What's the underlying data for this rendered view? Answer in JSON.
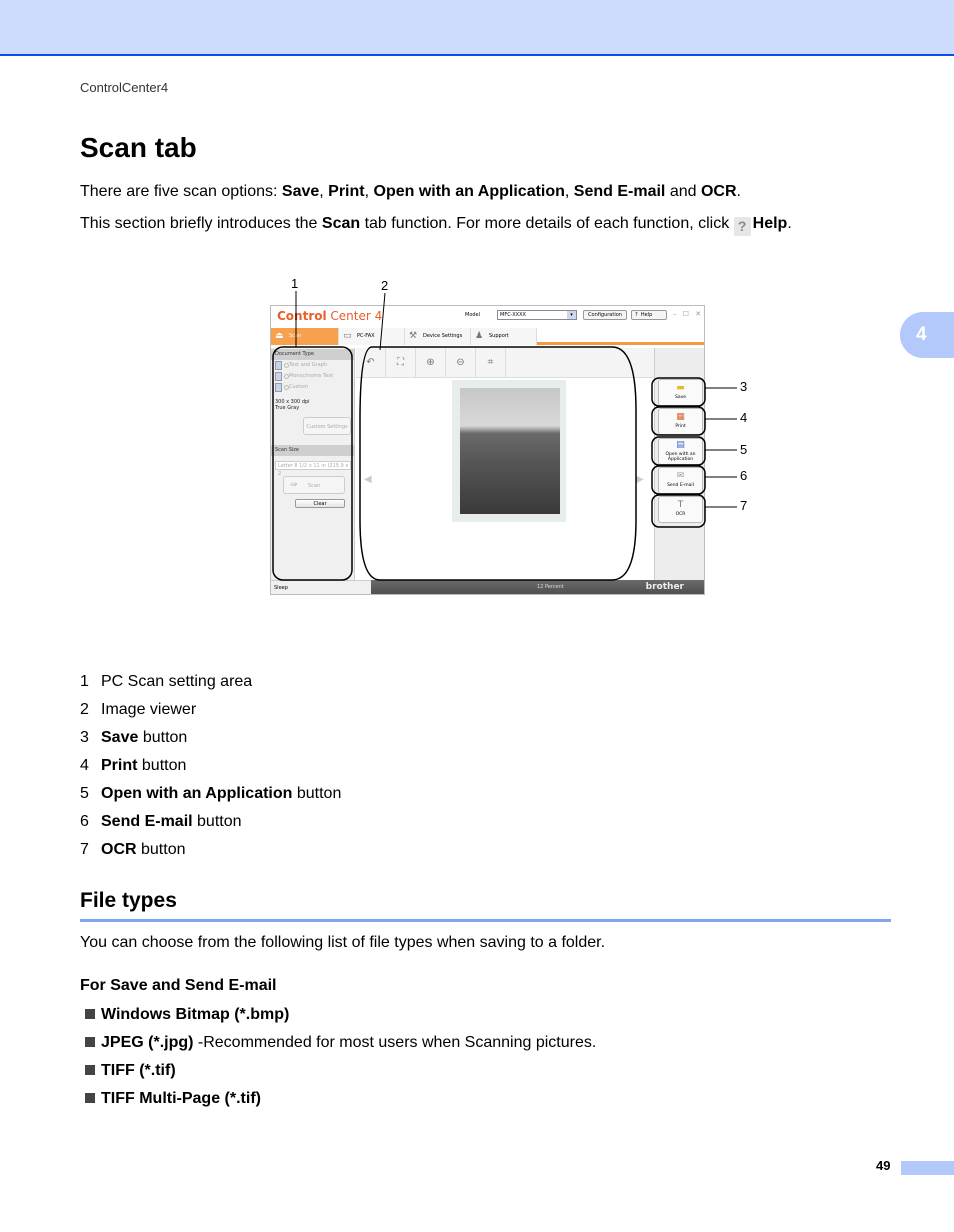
{
  "header": {
    "running_title": "ControlCenter4",
    "chapter_number": "4"
  },
  "title": "Scan tab",
  "intro": {
    "line1": {
      "prefix": "There are five scan options: ",
      "opt1": "Save",
      "sep1": ", ",
      "opt2": "Print",
      "sep2": ", ",
      "opt3": "Open with an Application",
      "sep3": ", ",
      "opt4": "Send E-mail",
      "sep4": " and ",
      "opt5": "OCR",
      "end": "."
    },
    "line2": {
      "prefix": "This section briefly introduces the ",
      "bold1": "Scan",
      "middle": " tab function. For more details of each function, click ",
      "help_icon": "?",
      "bold2": "Help",
      "end": "."
    }
  },
  "figure": {
    "app_logo_bold": "Control",
    "app_logo_rest": " Center 4",
    "model_label": "Model",
    "model_value": "MFC-XXXX",
    "configuration_label": "Configuration",
    "help_label": "Help",
    "help_icon": "?",
    "window_controls": "– ☐ ✕",
    "tabs": [
      {
        "label": "Scan",
        "icon": "scanner-icon",
        "active": true
      },
      {
        "label": "PC-FAX",
        "icon": "fax-icon",
        "active": false
      },
      {
        "label": "Device Settings",
        "icon": "tools-icon",
        "active": false
      },
      {
        "label": "Support",
        "icon": "person-icon",
        "active": false
      }
    ],
    "left_panel": {
      "document_type_heading": "Document Type",
      "document_types": [
        "Text and Graph",
        "Monochrome Text",
        "Custom"
      ],
      "selected_document_type": "Text and Graph",
      "resolution": "300 x 300 dpi",
      "color_mode": "True Gray",
      "custom_settings_label": "Custom Settings",
      "scan_size_heading": "Scan Size",
      "scan_size_value": "Letter 8 1/2 x 11 in (215.9 x 2",
      "scan_button": "Scan",
      "clear_button": "Clear"
    },
    "viewer_tools": [
      "rotate-icon",
      "fit-icon",
      "zoom-in-icon",
      "zoom-out-icon",
      "crop-icon"
    ],
    "action_buttons": [
      {
        "label": "Save",
        "icon": "folder-icon"
      },
      {
        "label": "Print",
        "icon": "printer-icon"
      },
      {
        "label": "Open with an Application",
        "icon": "application-icon"
      },
      {
        "label": "Send E-mail",
        "icon": "envelope-icon"
      },
      {
        "label": "OCR",
        "icon": "ocr-icon"
      }
    ],
    "status_left": "Sleep",
    "status_zoom": "12 Percent",
    "brand": "brother",
    "callout_numbers": [
      "1",
      "2",
      "3",
      "4",
      "5",
      "6",
      "7"
    ]
  },
  "legend": [
    {
      "num": "1",
      "bold": "",
      "text": "PC Scan setting area"
    },
    {
      "num": "2",
      "bold": "",
      "text": "Image viewer"
    },
    {
      "num": "3",
      "bold": "Save",
      "text": " button"
    },
    {
      "num": "4",
      "bold": "Print",
      "text": " button"
    },
    {
      "num": "5",
      "bold": "Open with an Application",
      "text": " button"
    },
    {
      "num": "6",
      "bold": "Send E-mail",
      "text": " button"
    },
    {
      "num": "7",
      "bold": "OCR",
      "text": " button"
    }
  ],
  "file_types": {
    "heading": "File types",
    "intro": "You can choose from the following list of file types when saving to a folder.",
    "subheading": "For Save and Send E-mail",
    "items": [
      {
        "bold": "Windows Bitmap (*.bmp)",
        "text": ""
      },
      {
        "bold": "JPEG (*.jpg)",
        "text": " -Recommended for most users when Scanning pictures."
      },
      {
        "bold": "TIFF (*.tif)",
        "text": ""
      },
      {
        "bold": "TIFF Multi-Page (*.tif)",
        "text": ""
      }
    ]
  },
  "footer": {
    "page_number": "49"
  },
  "colors": {
    "band": "#cddcfd",
    "band_rule": "#0a52e6",
    "section_rule": "#7fa6f2",
    "accent_orange": "#f7a14e",
    "logo_orange": "#e85f2a"
  }
}
